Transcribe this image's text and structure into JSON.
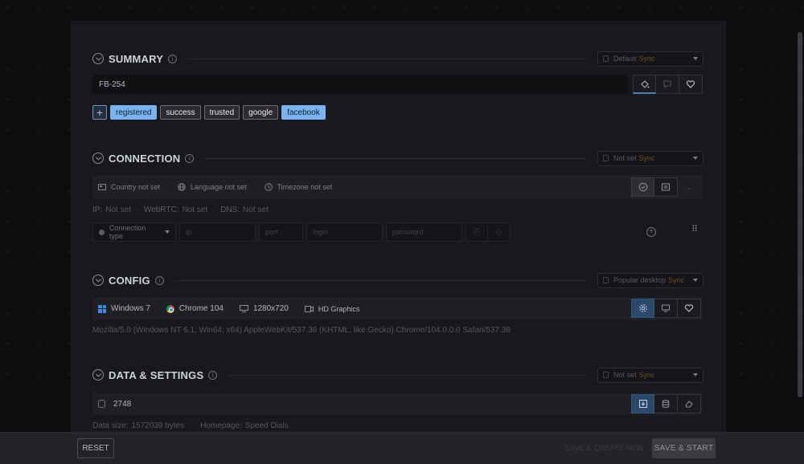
{
  "summary": {
    "title": "SUMMARY",
    "preset_label": "Default",
    "preset_tag": "Sync",
    "name_value": "FB-254",
    "tags": [
      "registered",
      "success",
      "trusted",
      "google",
      "facebook"
    ]
  },
  "connection": {
    "title": "CONNECTION",
    "preset_label": "Not set",
    "preset_tag": "Sync",
    "country": "Country not set",
    "language": "Language not set",
    "timezone": "Timezone not set",
    "ip_label": "IP:",
    "ip_value": "Not set",
    "webrtc_label": "WebRTC:",
    "webrtc_value": "Not set",
    "dns_label": "DNS:",
    "dns_value": "Not set",
    "proxy": {
      "type_label": "Connection type",
      "ip_placeholder": "ip",
      "port_placeholder": "port",
      "login_placeholder": "login",
      "password_placeholder": "password"
    }
  },
  "config": {
    "title": "CONFIG",
    "preset_label": "Popular desktop",
    "preset_tag": "Sync",
    "os": "Windows 7",
    "browser": "Chrome 104",
    "resolution": "1280x720",
    "graphics": "HD Graphics",
    "user_agent": "Mozilla/5.0 (Windows NT 6.1; Win64; x64) AppleWebKit/537.36 (KHTML, like Gecko) Chrome/104.0.0.0 Safari/537.36"
  },
  "data_settings": {
    "title": "DATA & SETTINGS",
    "preset_label": "Not set",
    "preset_tag": "Sync",
    "value": "2748",
    "data_size_label": "Data size:",
    "data_size_value": "1572039 bytes",
    "homepage_label": "Homepage:",
    "homepage_value": "Speed Dials"
  },
  "footer": {
    "reset_label": "RESET",
    "secondary_label": "SAVE & CREATE NEW",
    "save_label": "SAVE & START"
  }
}
